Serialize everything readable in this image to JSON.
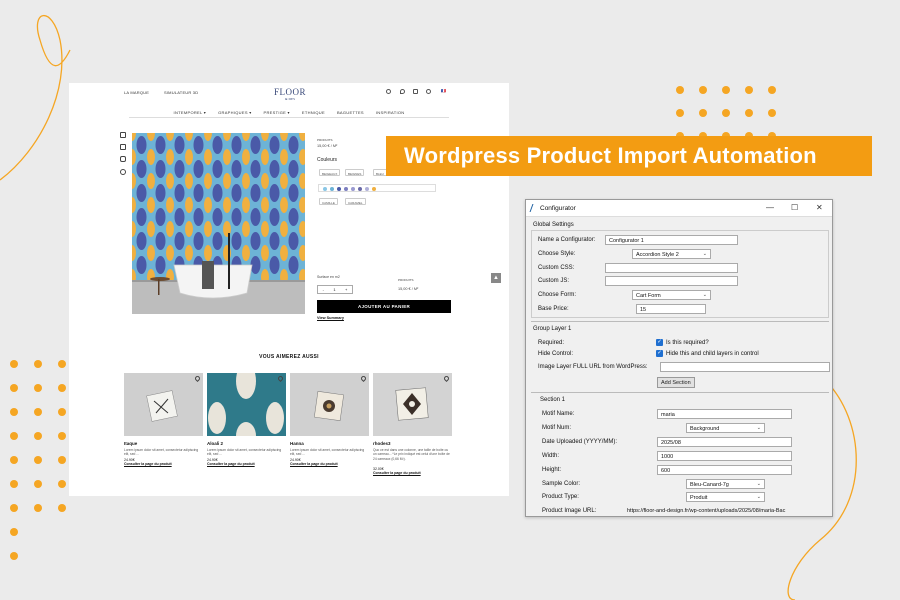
{
  "banner": {
    "title": "Wordpress Product Import Automation"
  },
  "site": {
    "nav_left": [
      "LA MARQUE",
      "SIMULATEUR 3D"
    ],
    "logo": {
      "line1": "FLOOR",
      "line2": "& DES"
    },
    "menu": [
      "INTEMPOREL ▾",
      "GRAPHIQUES ▾",
      "PRESTIGE ▾",
      "ETHNIQUE",
      "BAGUETTES",
      "INSPIRATION"
    ],
    "flag": "🇫🇷",
    "product": {
      "tag": "PRODUITS",
      "price": "15,00 € / M²",
      "colors_label": "Couleurs",
      "chips_row1": [
        "BEIGEAUX",
        "BEIGNES",
        "BLEU"
      ],
      "chips_row2": [
        "CAMILLE",
        "CARAMEL"
      ],
      "surface_label": "Surface en m2",
      "qty": "1",
      "qty_minus": "-",
      "qty_plus": "+",
      "total_tag": "PRODUITS",
      "total_price": "15,00 € / M²",
      "cart_button": "AJOUTER AU PANIER",
      "view_summary": "View Summary"
    },
    "scroll_top": "▲",
    "also_title": "VOUS AIMEREZ AUSSI",
    "products": [
      {
        "name": "Itaque",
        "desc": "Lorem ipsum dolor sit amet, consectetur adipiscing elit, sed ...",
        "price": "24.90€",
        "link": "Consulter la page du produit"
      },
      {
        "name": "Aloali 2",
        "desc": "Lorem ipsum dolor sit amet, consectetur adipiscing elit, sed ...",
        "price": "24.90€",
        "link": "Consulter la page du produit"
      },
      {
        "name": "Hanna",
        "desc": "Lorem ipsum dolor sit amet, consectetur adipiscing elit, sed ...",
        "price": "24.90€",
        "link": "Consulter la page du produit"
      },
      {
        "name": "rhodes3",
        "desc": "Quo ce est dans une colonne, une taille de boite ou un carreau... *Le prix indiqué est celui d'une boîte de 24 carreaux (0,66 M²).",
        "price": "32.00€",
        "link": "Consulter la page du produit"
      }
    ]
  },
  "configurator": {
    "window_title": "Configurator",
    "controls": {
      "minimize": "—",
      "maximize": "☐",
      "close": "✕"
    },
    "global_settings": "Global Settings",
    "name_label": "Name a Configurator:",
    "name_value": "Configurator 1",
    "style_label": "Choose Style:",
    "style_value": "Accordion Style 2",
    "css_label": "Custom CSS:",
    "js_label": "Custom JS:",
    "form_label": "Choose Form:",
    "form_value": "Cart Form",
    "base_price_label": "Base Price:",
    "base_price_value": "15",
    "group_layer": "Group Layer 1",
    "required_label": "Required:",
    "required_text": "Is this required?",
    "hide_label": "Hide Control:",
    "hide_text": "Hide this and child layers in control",
    "image_url_label": "Image Layer FULL URL from WordPress:",
    "add_section": "Add Section",
    "section": "Section 1",
    "motif_name_label": "Motif Name:",
    "motif_name_value": "maria",
    "motif_num_label": "Motif Num:",
    "motif_num_value": "Background",
    "date_label": "Date Uploaded (YYYY/MM):",
    "date_value": "2025/08",
    "width_label": "Width:",
    "width_value": "1000",
    "height_label": "Height:",
    "height_value": "600",
    "sample_color_label": "Sample Color:",
    "sample_color_value": "Bleu-Canard-7g",
    "product_type_label": "Product Type:",
    "product_type_value": "Produit",
    "product_url_label": "Product Image URL:",
    "product_url_value": "https://floor-and-design.fr/wp-content/uploads/2025/08/maria-Bac"
  },
  "colors": {
    "accent": "#f39c12",
    "check": "#1f6fd0"
  }
}
